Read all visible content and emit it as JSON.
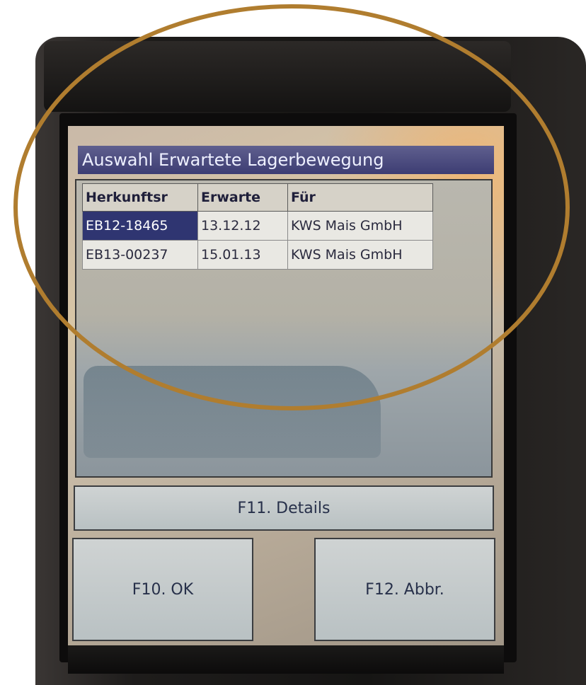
{
  "window": {
    "title": "Auswahl Erwartete Lagerbewegung"
  },
  "table": {
    "columns": [
      "Herkunftsr",
      "Erwarte",
      "Für"
    ],
    "rows": [
      {
        "origin": "EB12-18465",
        "expected": "13.12.12",
        "for": "KWS Mais GmbH",
        "selected": true
      },
      {
        "origin": "EB13-00237",
        "expected": "15.01.13",
        "for": "KWS Mais GmbH",
        "selected": false
      }
    ]
  },
  "buttons": {
    "details": "F11. Details",
    "ok": "F10. OK",
    "cancel": "F12. Abbr."
  },
  "colors": {
    "title_bar": "#3d3d73",
    "selection": "#2f3571",
    "annotation_ellipse": "#b07d2f"
  }
}
